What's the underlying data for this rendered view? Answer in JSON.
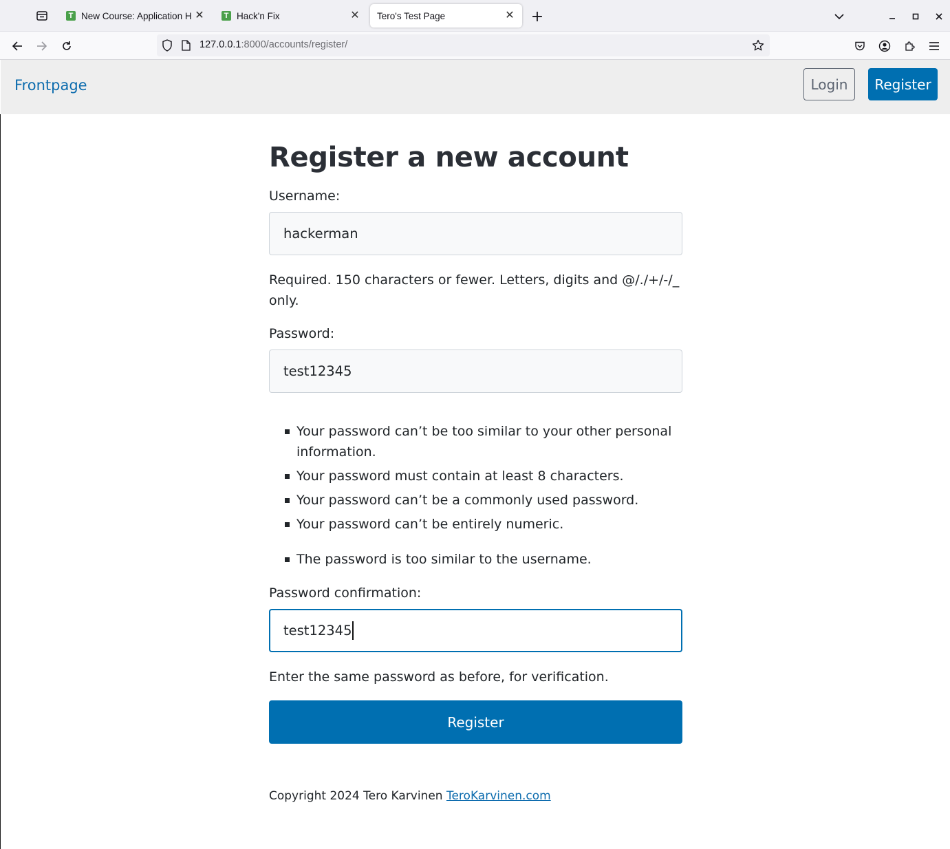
{
  "browser": {
    "tabs": [
      {
        "title": "New Course: Application H",
        "favicon_letter": "T",
        "active": false
      },
      {
        "title": "Hack'n Fix",
        "favicon_letter": "T",
        "active": false
      },
      {
        "title": "Tero's Test Page",
        "active": true
      }
    ],
    "url_host": "127.0.0.1",
    "url_rest": ":8000/accounts/register/"
  },
  "header": {
    "frontpage_link": "Frontpage",
    "login_button": "Login",
    "register_button": "Register"
  },
  "form": {
    "title": "Register a new account",
    "username_label": "Username:",
    "username_value": "hackerman",
    "username_help": "Required. 150 characters or fewer. Letters, digits and @/./+/-/_ only.",
    "password_label": "Password:",
    "password_value": "test12345",
    "password_rules": [
      "Your password can’t be too similar to your other personal information.",
      "Your password must contain at least 8 characters.",
      "Your password can’t be a commonly used password.",
      "Your password can’t be entirely numeric."
    ],
    "password_error": "The password is too similar to the username.",
    "confirm_label": "Password confirmation:",
    "confirm_value": "test12345",
    "confirm_help": "Enter the same password as before, for verification.",
    "submit_button": "Register"
  },
  "footer": {
    "copyright": "Copyright 2024 Tero Karvinen",
    "link": "TeroKarvinen.com"
  },
  "colors": {
    "primary": "#006fb1",
    "link": "#0d6cae",
    "header_bg": "#eeeeee"
  }
}
